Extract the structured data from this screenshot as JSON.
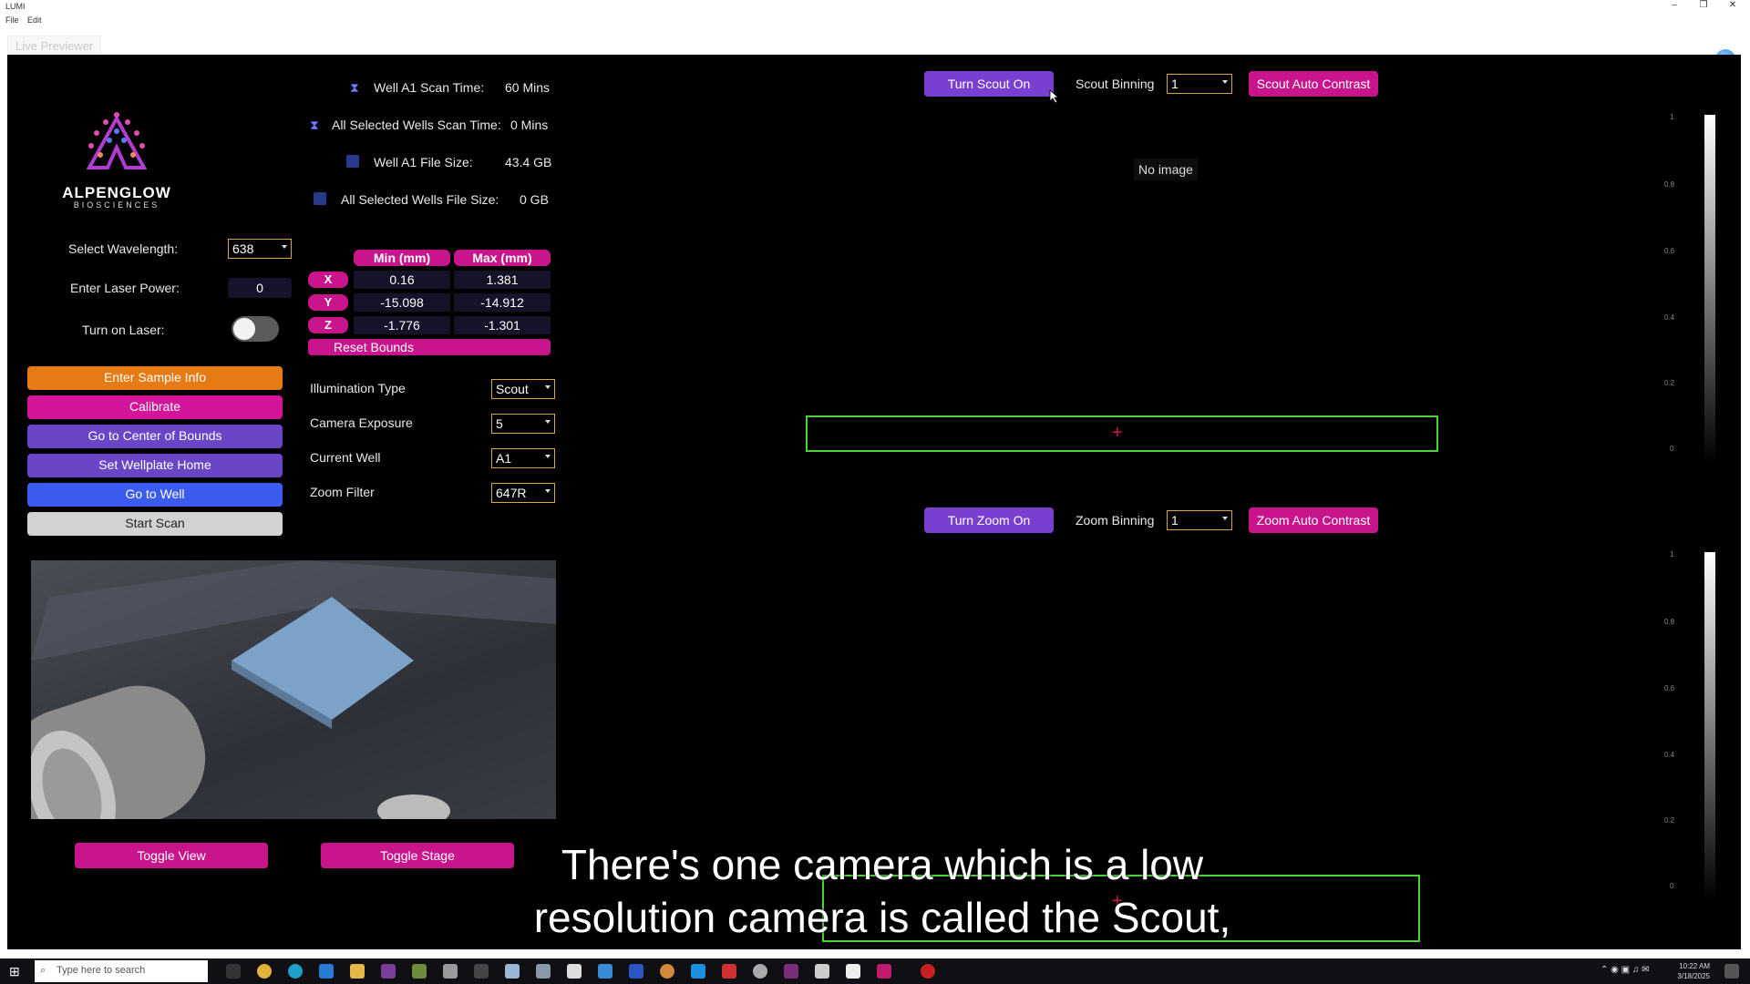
{
  "window": {
    "title": "LUMI",
    "menu": [
      "File",
      "Edit"
    ],
    "tab": "Live Previewer",
    "controls": [
      "–",
      "❐",
      "✕"
    ]
  },
  "logo": {
    "name": "ALPENGLOW",
    "sub": "BIOSCIENCES"
  },
  "stats": [
    {
      "label": "Well A1 Scan Time:",
      "value": "60 Mins",
      "icon": "hourglass-icon"
    },
    {
      "label": "All Selected Wells Scan Time:",
      "value": "0 Mins",
      "icon": "hourglass-icon"
    },
    {
      "label": "Well A1 File Size:",
      "value": "43.4 GB",
      "icon": "disk-icon"
    },
    {
      "label": "All Selected Wells File Size:",
      "value": "0 GB",
      "icon": "disk-icon"
    }
  ],
  "laser": {
    "wavelength_label": "Select Wavelength:",
    "wavelength_value": "638",
    "power_label": "Enter Laser Power:",
    "power_value": "0",
    "toggle_label": "Turn on Laser:",
    "toggle_on": false
  },
  "bounds": {
    "min_header": "Min (mm)",
    "max_header": "Max (mm)",
    "rows": [
      {
        "axis": "X",
        "min": "0.16",
        "max": "1.381"
      },
      {
        "axis": "Y",
        "min": "-15.098",
        "max": "-14.912"
      },
      {
        "axis": "Z",
        "min": "-1.776",
        "max": "-1.301"
      }
    ],
    "reset_label": "Reset Bounds"
  },
  "settings": [
    {
      "label": "Illumination Type",
      "value": "Scout"
    },
    {
      "label": "Camera Exposure",
      "value": "5"
    },
    {
      "label": "Current Well",
      "value": "A1"
    },
    {
      "label": "Zoom Filter",
      "value": "647R"
    }
  ],
  "actions": [
    "Enter Sample Info",
    "Calibrate",
    "Go to Center of Bounds",
    "Set Wellplate Home",
    "Go to Well",
    "Start Scan"
  ],
  "view_buttons": {
    "toggle_view": "Toggle View",
    "toggle_stage": "Toggle Stage"
  },
  "scout": {
    "on_label": "Turn Scout On",
    "binning_label": "Scout Binning",
    "binning_value": "1",
    "auto_contrast": "Scout Auto Contrast",
    "no_image": "No image"
  },
  "zoom": {
    "on_label": "Turn Zoom On",
    "binning_label": "Zoom Binning",
    "binning_value": "1",
    "auto_contrast": "Zoom Auto Contrast"
  },
  "scale_ticks": [
    "1",
    "0.8",
    "0.6",
    "0.4",
    "0.2",
    "0"
  ],
  "caption": {
    "line1": "There's one camera which is a low",
    "line2": "resolution camera is called the Scout,"
  },
  "taskbar": {
    "search_placeholder": "Type here to search",
    "time": "10:22 AM",
    "date": "3/18/2025"
  },
  "colors": {
    "accent": "#c8158c",
    "frame": "#4bd33b",
    "background": "#000000"
  }
}
